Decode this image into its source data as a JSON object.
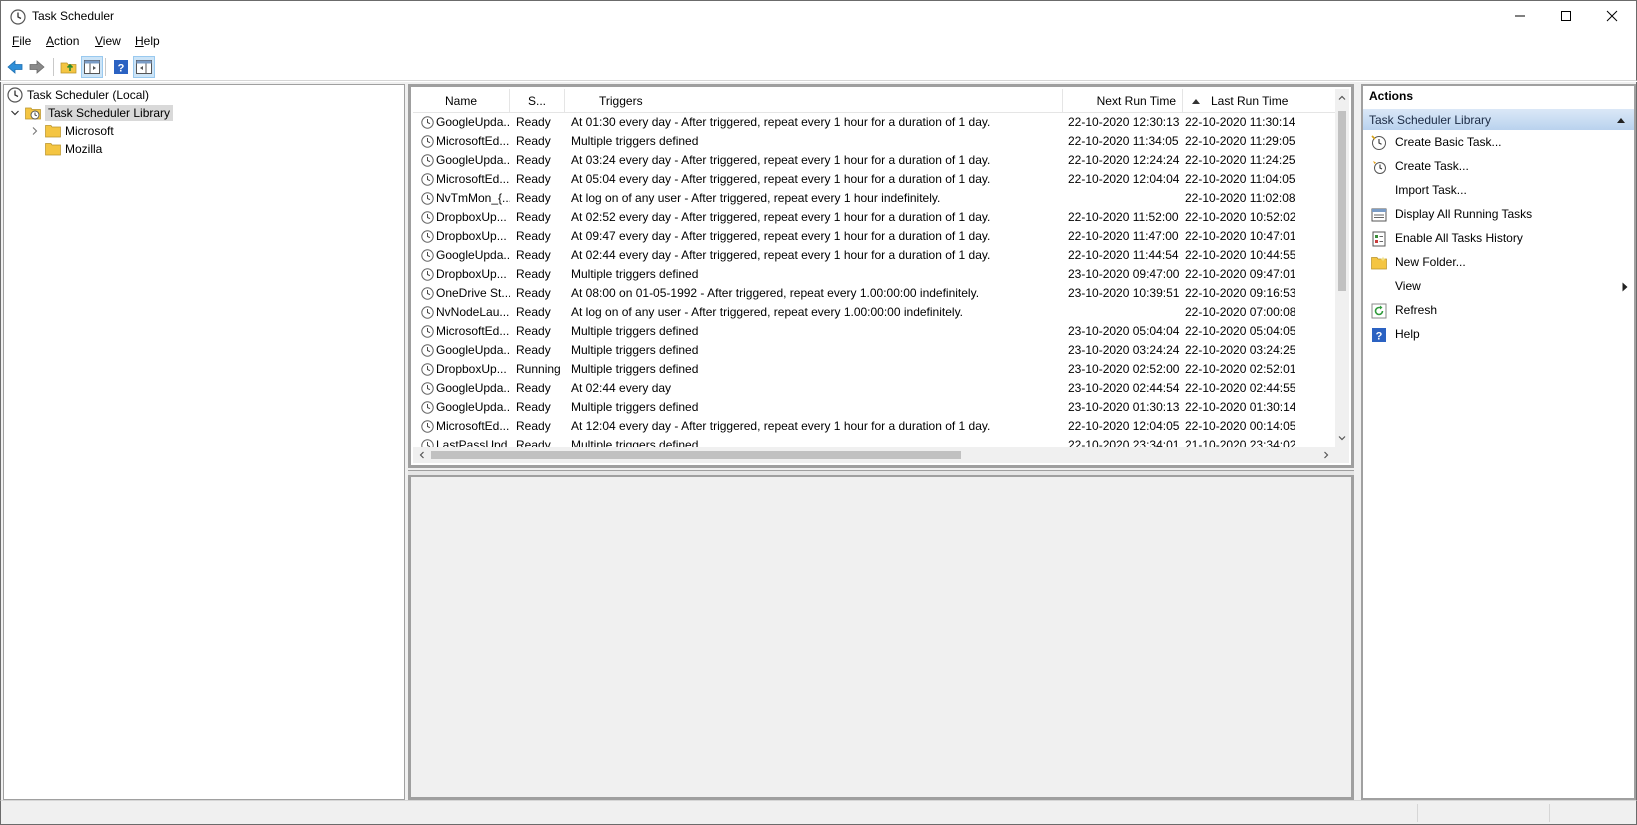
{
  "window": {
    "title": "Task Scheduler"
  },
  "menu": {
    "items": [
      {
        "label": "File",
        "u": "F",
        "rest": "ile"
      },
      {
        "label": "Action",
        "u": "A",
        "rest": "ction"
      },
      {
        "label": "View",
        "u": "V",
        "rest": "iew"
      },
      {
        "label": "Help",
        "u": "H",
        "rest": "elp"
      }
    ]
  },
  "toolbar": {
    "buttons": [
      "back-icon",
      "forward-icon",
      "up-folder-icon",
      "show-hide-console-tree-icon",
      "help-icon",
      "show-hide-action-pane-icon"
    ]
  },
  "tree": {
    "root": "Task Scheduler (Local)",
    "library": "Task Scheduler Library",
    "children": [
      "Microsoft",
      "Mozilla"
    ]
  },
  "list": {
    "headers": {
      "name": "Name",
      "status": "S...",
      "triggers": "Triggers",
      "next_run": "Next Run Time",
      "last_run": "Last Run Time"
    },
    "rows": [
      {
        "name": "GoogleUpda...",
        "status": "Ready",
        "triggers": "At 01:30 every day - After triggered, repeat every 1 hour for a duration of 1 day.",
        "next": "22-10-2020 12:30:13",
        "last": "22-10-2020 11:30:14"
      },
      {
        "name": "MicrosoftEd...",
        "status": "Ready",
        "triggers": "Multiple triggers defined",
        "next": "22-10-2020 11:34:05",
        "last": "22-10-2020 11:29:05"
      },
      {
        "name": "GoogleUpda...",
        "status": "Ready",
        "triggers": "At 03:24 every day - After triggered, repeat every 1 hour for a duration of 1 day.",
        "next": "22-10-2020 12:24:24",
        "last": "22-10-2020 11:24:25"
      },
      {
        "name": "MicrosoftEd...",
        "status": "Ready",
        "triggers": "At 05:04 every day - After triggered, repeat every 1 hour for a duration of 1 day.",
        "next": "22-10-2020 12:04:04",
        "last": "22-10-2020 11:04:05"
      },
      {
        "name": "NvTmMon_{...",
        "status": "Ready",
        "triggers": "At log on of any user - After triggered, repeat every 1 hour indefinitely.",
        "next": "",
        "last": "22-10-2020 11:02:08"
      },
      {
        "name": "DropboxUp...",
        "status": "Ready",
        "triggers": "At 02:52 every day - After triggered, repeat every 1 hour for a duration of 1 day.",
        "next": "22-10-2020 11:52:00",
        "last": "22-10-2020 10:52:02"
      },
      {
        "name": "DropboxUp...",
        "status": "Ready",
        "triggers": "At 09:47 every day - After triggered, repeat every 1 hour for a duration of 1 day.",
        "next": "22-10-2020 11:47:00",
        "last": "22-10-2020 10:47:01"
      },
      {
        "name": "GoogleUpda...",
        "status": "Ready",
        "triggers": "At 02:44 every day - After triggered, repeat every 1 hour for a duration of 1 day.",
        "next": "22-10-2020 11:44:54",
        "last": "22-10-2020 10:44:55"
      },
      {
        "name": "DropboxUp...",
        "status": "Ready",
        "triggers": "Multiple triggers defined",
        "next": "23-10-2020 09:47:00",
        "last": "22-10-2020 09:47:01"
      },
      {
        "name": "OneDrive St...",
        "status": "Ready",
        "triggers": "At 08:00 on 01-05-1992 - After triggered, repeat every 1.00:00:00 indefinitely.",
        "next": "23-10-2020 10:39:51",
        "last": "22-10-2020 09:16:53"
      },
      {
        "name": "NvNodeLau...",
        "status": "Ready",
        "triggers": "At log on of any user - After triggered, repeat every 1.00:00:00 indefinitely.",
        "next": "",
        "last": "22-10-2020 07:00:08"
      },
      {
        "name": "MicrosoftEd...",
        "status": "Ready",
        "triggers": "Multiple triggers defined",
        "next": "23-10-2020 05:04:04",
        "last": "22-10-2020 05:04:05"
      },
      {
        "name": "GoogleUpda...",
        "status": "Ready",
        "triggers": "Multiple triggers defined",
        "next": "23-10-2020 03:24:24",
        "last": "22-10-2020 03:24:25"
      },
      {
        "name": "DropboxUp...",
        "status": "Running",
        "triggers": "Multiple triggers defined",
        "next": "23-10-2020 02:52:00",
        "last": "22-10-2020 02:52:01"
      },
      {
        "name": "GoogleUpda...",
        "status": "Ready",
        "triggers": "At 02:44 every day",
        "next": "23-10-2020 02:44:54",
        "last": "22-10-2020 02:44:55"
      },
      {
        "name": "GoogleUpda...",
        "status": "Ready",
        "triggers": "Multiple triggers defined",
        "next": "23-10-2020 01:30:13",
        "last": "22-10-2020 01:30:14"
      },
      {
        "name": "MicrosoftEd...",
        "status": "Ready",
        "triggers": "At 12:04 every day - After triggered, repeat every 1 hour for a duration of 1 day.",
        "next": "22-10-2020 12:04:05",
        "last": "22-10-2020 00:14:05"
      },
      {
        "name": "LastPassUpd...",
        "status": "Ready",
        "triggers": "Multiple triggers defined",
        "next": "22-10-2020 23:34:01",
        "last": "21-10-2020 23:34:02"
      }
    ]
  },
  "actions": {
    "title": "Actions",
    "section": "Task Scheduler Library",
    "items": [
      {
        "label": "Create Basic Task...",
        "icon": "create-basic-task-icon"
      },
      {
        "label": "Create Task...",
        "icon": "create-task-icon"
      },
      {
        "label": "Import Task...",
        "icon": ""
      },
      {
        "label": "Display All Running Tasks",
        "icon": "display-running-tasks-icon"
      },
      {
        "label": "Enable All Tasks History",
        "icon": "enable-history-icon"
      },
      {
        "label": "New Folder...",
        "icon": "new-folder-icon"
      },
      {
        "label": "View",
        "icon": "",
        "submenu": true
      },
      {
        "label": "Refresh",
        "icon": "refresh-icon"
      },
      {
        "label": "Help",
        "icon": "help-icon"
      }
    ]
  },
  "colors": {
    "selection_bg": "#d9d9d9",
    "section_header": "#c5dbf2",
    "help_blue": "#2b62c2",
    "folder_yellow": "#f4c542"
  }
}
